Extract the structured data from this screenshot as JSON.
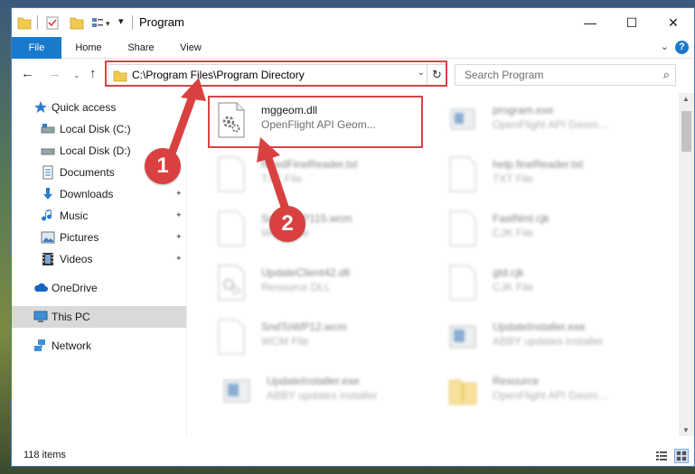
{
  "window": {
    "title": "Program",
    "minimize": "—",
    "maximize": "☐",
    "close": "✕"
  },
  "ribbon": {
    "tabs": [
      "File",
      "Home",
      "Share",
      "View"
    ],
    "help": "?",
    "expand": "⌄"
  },
  "nav": {
    "back": "←",
    "forward": "→",
    "recent": "⌄",
    "up": "↑",
    "address": "C:\\Program Files\\Program Directory",
    "dropdown": "⌄",
    "refresh": "↻",
    "search_placeholder": "Search Program",
    "search_icon": "⌕"
  },
  "sidebar": {
    "items": [
      {
        "label": "Quick access",
        "icon": "star-icon"
      },
      {
        "label": "Local Disk (C:)",
        "icon": "drive-icon"
      },
      {
        "label": "Local Disk (D:)",
        "icon": "drive-icon"
      },
      {
        "label": "Documents",
        "icon": "documents-icon"
      },
      {
        "label": "Downloads",
        "icon": "downloads-icon"
      },
      {
        "label": "Music",
        "icon": "music-icon"
      },
      {
        "label": "Pictures",
        "icon": "pictures-icon"
      },
      {
        "label": "Videos",
        "icon": "videos-icon"
      },
      {
        "label": "OneDrive",
        "icon": "cloud-icon"
      },
      {
        "label": "This PC",
        "icon": "computer-icon"
      },
      {
        "label": "Network",
        "icon": "network-icon"
      }
    ],
    "pin": "📌"
  },
  "files": [
    {
      "name": "mggeom.dll",
      "type": "OpenFlight API Geom...",
      "icon": "dll-gear-icon"
    },
    {
      "name": "program.exe",
      "type": "OpenFlight API Geom...",
      "icon": "exe-icon"
    },
    {
      "name": "help.fineReader.txt",
      "type": "TXT File",
      "icon": "document-icon"
    },
    {
      "name": "NeedFineReader.txt",
      "type": "TXT File",
      "icon": "document-icon"
    },
    {
      "name": "FastNml.cjk",
      "type": "CJK File",
      "icon": "document-icon"
    },
    {
      "name": "SndToWP115.wcm",
      "type": "WCM File",
      "icon": "document-icon"
    },
    {
      "name": "gtd.cjk",
      "type": "CJK File",
      "icon": "document-icon"
    },
    {
      "name": "UpdateClient42.dll",
      "type": "Resource DLL",
      "icon": "dll-gear-icon"
    },
    {
      "name": "UpdateInstaller.exe",
      "type": "ABBY updates installer",
      "icon": "installer-icon"
    },
    {
      "name": "SndToWP12.wcm",
      "type": "WCM File",
      "icon": "document-icon"
    },
    {
      "name": "Resource",
      "type": "OpenFlight API Geom...",
      "icon": "folder-zip-icon"
    },
    {
      "name": "UpdateInstaller.exe",
      "type": "ABBY updates installer",
      "icon": "installer-icon"
    }
  ],
  "status": {
    "item_count": "118 items"
  },
  "annotations": {
    "badge1": "1",
    "badge2": "2"
  },
  "colors": {
    "accent": "#1979ca",
    "highlight": "#d64545",
    "badge": "#d94040"
  }
}
